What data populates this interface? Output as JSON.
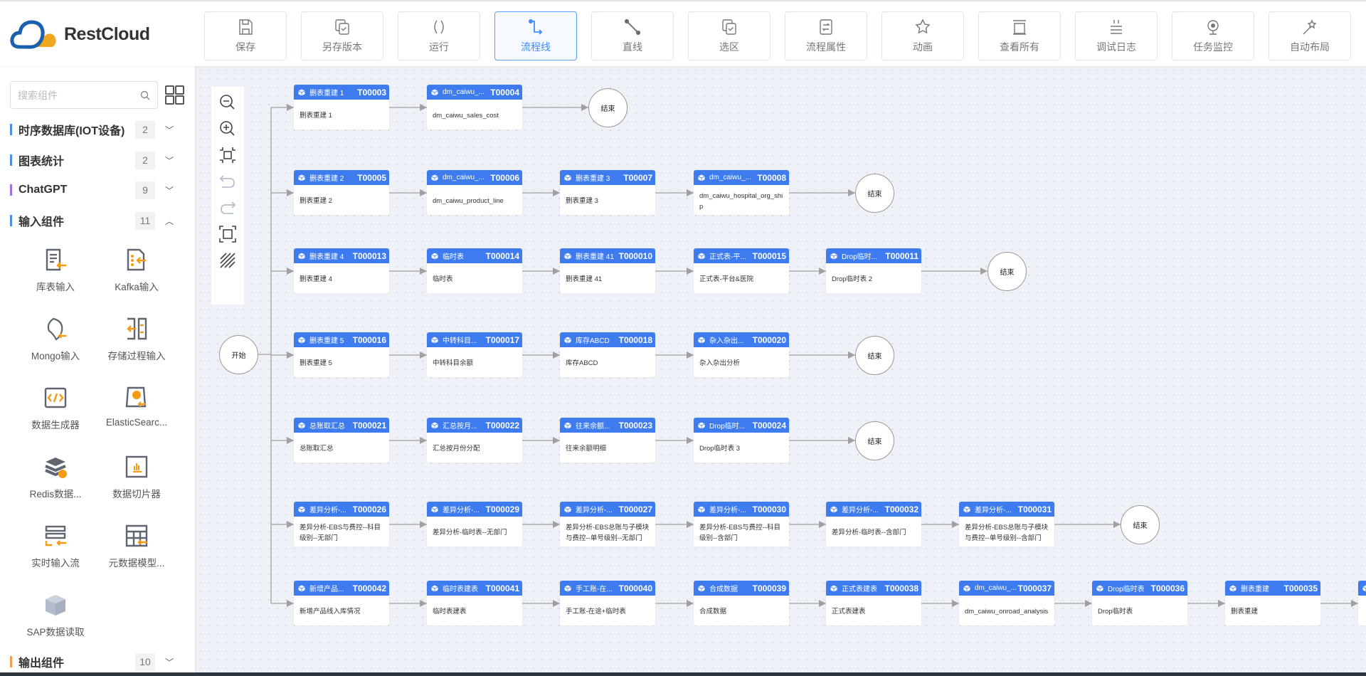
{
  "brand": {
    "name": "RestCloud",
    "colors": {
      "cloud_blue": "#1b5fb0",
      "cloud_orange": "#f0a820",
      "node_header": "#3e7bef",
      "accent": "#3f8cff"
    }
  },
  "toolbar": [
    {
      "label": "保存",
      "icon": "save-icon"
    },
    {
      "label": "另存版本",
      "icon": "copy-check-icon"
    },
    {
      "label": "运行",
      "icon": "run-icon"
    },
    {
      "label": "流程线",
      "icon": "flow-line-icon",
      "active": true
    },
    {
      "label": "直线",
      "icon": "straight-line-icon"
    },
    {
      "label": "选区",
      "icon": "selection-icon"
    },
    {
      "label": "流程属性",
      "icon": "properties-icon"
    },
    {
      "label": "动画",
      "icon": "star-animation-icon"
    },
    {
      "label": "查看所有",
      "icon": "view-all-icon"
    },
    {
      "label": "调试日志",
      "icon": "debug-log-icon"
    },
    {
      "label": "任务监控",
      "icon": "monitor-icon"
    },
    {
      "label": "自动布局",
      "icon": "magic-wand-icon"
    }
  ],
  "sidebar": {
    "search": {
      "placeholder": "搜索组件",
      "value": ""
    },
    "categories": [
      {
        "name": "时序数据库(IOT设备)",
        "count": "2",
        "color": "#4d8df7",
        "expanded": false
      },
      {
        "name": "图表统计",
        "count": "2",
        "color": "#4d8df7",
        "expanded": false
      },
      {
        "name": "ChatGPT",
        "count": "9",
        "color": "#a86ee0",
        "expanded": false
      },
      {
        "name": "输入组件",
        "count": "11",
        "color": "#4d8df7",
        "expanded": true
      },
      {
        "name": "输出组件",
        "count": "10",
        "color": "#f0a050",
        "expanded": false
      }
    ],
    "components": [
      {
        "label": "库表输入",
        "icon": "table-input-icon"
      },
      {
        "label": "Kafka输入",
        "icon": "kafka-input-icon"
      },
      {
        "label": "Mongo输入",
        "icon": "mongo-input-icon"
      },
      {
        "label": "存储过程输入",
        "icon": "procedure-input-icon"
      },
      {
        "label": "数据生成器",
        "icon": "code-generator-icon"
      },
      {
        "label": "ElasticSearc...",
        "icon": "elasticsearch-icon"
      },
      {
        "label": "Redis数据...",
        "icon": "redis-icon"
      },
      {
        "label": "数据切片器",
        "icon": "data-slicer-icon"
      },
      {
        "label": "实时输入流",
        "icon": "stream-input-icon"
      },
      {
        "label": "元数据模型...",
        "icon": "metadata-model-icon"
      },
      {
        "label": "SAP数据读取",
        "icon": "sap-cube-icon"
      }
    ]
  },
  "flow": {
    "start_label": "开始",
    "end_label": "结束",
    "rows": [
      {
        "has_end": true,
        "nodes": [
          {
            "title": "删表重建 1",
            "id": "T00003",
            "text": "删表重建 1"
          },
          {
            "title": "dm_caiwu_...",
            "id": "T00004",
            "text": "dm_caiwu_sales_cost"
          }
        ]
      },
      {
        "has_end": true,
        "nodes": [
          {
            "title": "删表重建 2",
            "id": "T00005",
            "text": "删表重建 2"
          },
          {
            "title": "dm_caiwu_...",
            "id": "T00006",
            "text": "dm_caiwu_product_line"
          },
          {
            "title": "删表重建 3",
            "id": "T00007",
            "text": "删表重建 3"
          },
          {
            "title": "dm_caiwu_...",
            "id": "T00008",
            "text": "dm_caiwu_hospital_org_ship"
          }
        ]
      },
      {
        "has_end": true,
        "nodes": [
          {
            "title": "删表重建 4",
            "id": "T000013",
            "text": "删表重建 4"
          },
          {
            "title": "临时表",
            "id": "T000014",
            "text": "临时表"
          },
          {
            "title": "删表重建 41",
            "id": "T000010",
            "text": "删表重建 41"
          },
          {
            "title": "正式表-平...",
            "id": "T000015",
            "text": "正式表-平台&医院"
          },
          {
            "title": "Drop临时...",
            "id": "T000011",
            "text": "Drop临时表 2"
          }
        ]
      },
      {
        "has_end": true,
        "nodes": [
          {
            "title": "删表重建 5",
            "id": "T000016",
            "text": "删表重建 5"
          },
          {
            "title": "中转科目...",
            "id": "T000017",
            "text": "中转科目余额"
          },
          {
            "title": "库存ABCD",
            "id": "T000018",
            "text": "库存ABCD"
          },
          {
            "title": "杂入杂出...",
            "id": "T000020",
            "text": "杂入杂出分析"
          }
        ]
      },
      {
        "has_end": true,
        "nodes": [
          {
            "title": "总账取汇总",
            "id": "T000021",
            "text": "总账取汇总"
          },
          {
            "title": "汇总按月...",
            "id": "T000022",
            "text": "汇总按月份分配"
          },
          {
            "title": "往来余额...",
            "id": "T000023",
            "text": "往来余额明细"
          },
          {
            "title": "Drop临时...",
            "id": "T000024",
            "text": "Drop临时表 3"
          }
        ]
      },
      {
        "has_end": true,
        "nodes": [
          {
            "title": "差异分析-...",
            "id": "T000026",
            "text": "差异分析-EBS与费控--科目级别--无部门"
          },
          {
            "title": "差异分析-...",
            "id": "T000029",
            "text": "差异分析-临时表--无部门"
          },
          {
            "title": "差异分析-...",
            "id": "T000027",
            "text": "差异分析-EBS总账与子模块与费控--单号级别--无部门"
          },
          {
            "title": "差异分析-...",
            "id": "T000030",
            "text": "差异分析-EBS与费控--科目级别--含部门"
          },
          {
            "title": "差异分析-...",
            "id": "T000032",
            "text": "差异分析-临时表--含部门"
          },
          {
            "title": "差异分析-...",
            "id": "T000031",
            "text": "差异分析-EBS总账与子模块与费控--单号级别--含部门"
          }
        ]
      },
      {
        "has_end": false,
        "nodes": [
          {
            "title": "新增产品...",
            "id": "T000042",
            "text": "新增产品线入库情况"
          },
          {
            "title": "临时表建表",
            "id": "T000041",
            "text": "临时表建表"
          },
          {
            "title": "手工账-在...",
            "id": "T000040",
            "text": "手工账-在途+临时表"
          },
          {
            "title": "合成数据",
            "id": "T000039",
            "text": "合成数据"
          },
          {
            "title": "正式表建表",
            "id": "T000038",
            "text": "正式表建表"
          },
          {
            "title": "dm_caiwu_...",
            "id": "T000037",
            "text": "dm_caiwu_onroad_analysis"
          },
          {
            "title": "Drop临时表",
            "id": "T000036",
            "text": "Drop临时表"
          },
          {
            "title": "删表重建",
            "id": "T000035",
            "text": "删表重建"
          },
          {
            "title": "",
            "id": "",
            "text": ""
          }
        ]
      }
    ]
  }
}
